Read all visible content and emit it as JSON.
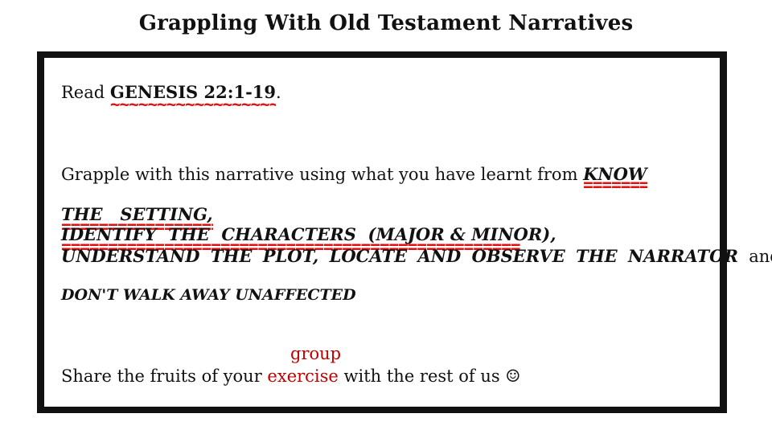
{
  "title": "Grappling With Old Testament Narratives",
  "read": {
    "prefix": "Read ",
    "passage": "GENESIS 22:1-19",
    "suffix": "."
  },
  "instruction": {
    "lead": "Grapple with this narrative using what you have learnt from ",
    "know": "KNOW",
    "the1": "THE",
    "setting": "SETTING,",
    "identify": "IDENTIFY",
    "the2": "THE",
    "characters": "CHARACTERS",
    "major_minor": "(MAJOR & MINOR),",
    "understand": "UNDERSTAND",
    "the3": "THE",
    "plot": "PLOT,",
    "locate": "LOCATE",
    "and1": "AND",
    "observe": "OBSERVE",
    "the4": "THE",
    "narrator": "NARRATOR",
    "and2": "and",
    "unaffected": "DON'T WALK AWAY UNAFFECTED"
  },
  "share": {
    "prefix": "Share the fruits of your ",
    "correction": "group",
    "struck": "exercise",
    "suffix": " with the rest of us ☺"
  },
  "marks": {
    "wavy": "~~~~~~~~~~~~~~~~~~",
    "double": "=================================================",
    "color": "#e01010"
  }
}
